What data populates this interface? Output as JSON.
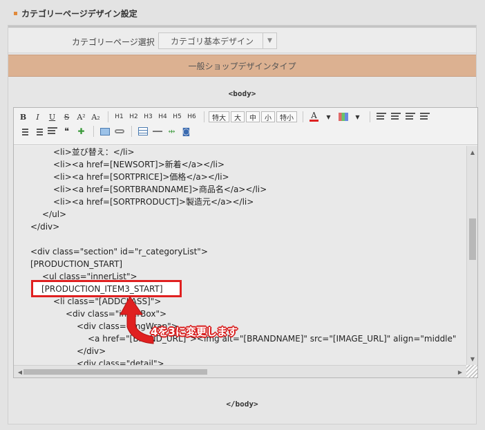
{
  "section": {
    "title": "カテゴリーページデザイン設定"
  },
  "category_select": {
    "label": "カテゴリーページ選択",
    "selected": "カテゴリ基本デザイン"
  },
  "band": {
    "label": "一般ショップデザインタイプ"
  },
  "body_tags": {
    "open": "<body>",
    "close": "</body>"
  },
  "toolbar": {
    "row1": {
      "format": [
        {
          "name": "bold-button",
          "label": "B"
        },
        {
          "name": "italic-button",
          "label": "I"
        },
        {
          "name": "underline-button",
          "label": "U"
        },
        {
          "name": "strikethrough-button",
          "label": "S"
        },
        {
          "name": "superscript-button",
          "label": "A²"
        },
        {
          "name": "subscript-button",
          "label": "A₂"
        }
      ],
      "headings": [
        "H1",
        "H2",
        "H3",
        "H4",
        "H5",
        "H6"
      ],
      "sizes": [
        "特大",
        "大",
        "中",
        "小",
        "特小"
      ],
      "font_color_label": "A"
    }
  },
  "code_lines": [
    {
      "indent": 2,
      "text": "<li>並び替え：</li>"
    },
    {
      "indent": 2,
      "text": "<li><a href=[NEWSORT]>新着</a></li>"
    },
    {
      "indent": 2,
      "text": "<li><a href=[SORTPRICE]>価格</a></li>"
    },
    {
      "indent": 2,
      "text": "<li><a href=[SORTBRANDNAME]>商品名</a></li>"
    },
    {
      "indent": 2,
      "text": "<li><a href=[SORTPRODUCT]>製造元</a></li>"
    },
    {
      "indent": 1,
      "text": "</ul>"
    },
    {
      "indent": 0,
      "text": "</div>"
    },
    {
      "indent": 0,
      "text": ""
    },
    {
      "indent": 0,
      "text": "<div class=\"section\" id=\"r_categoryList\">"
    },
    {
      "indent": 0,
      "text": "[PRODUCTION_START]"
    },
    {
      "indent": 1,
      "text": "<ul class=\"innerList\">"
    },
    {
      "indent": 1,
      "text": ""
    },
    {
      "indent": 2,
      "text": "<li class=\"[ADDCLASS]\">"
    },
    {
      "indent": 3,
      "text": "<div class=\"innerBox\">"
    },
    {
      "indent": 4,
      "text": "<div class=\"imgWrap\">"
    },
    {
      "indent": 5,
      "text": "<a href=\"[BRAND_URL]\"><img alt=\"[BRANDNAME]\" src=\"[IMAGE_URL]\" align=\"middle\""
    },
    {
      "indent": 4,
      "text": "</div>"
    },
    {
      "indent": 4,
      "text": "<div class=\"detail\">"
    }
  ],
  "highlight": {
    "text": "[PRODUCTION_ITEM3_START]"
  },
  "annotation": {
    "text": "4を3に変更します"
  }
}
